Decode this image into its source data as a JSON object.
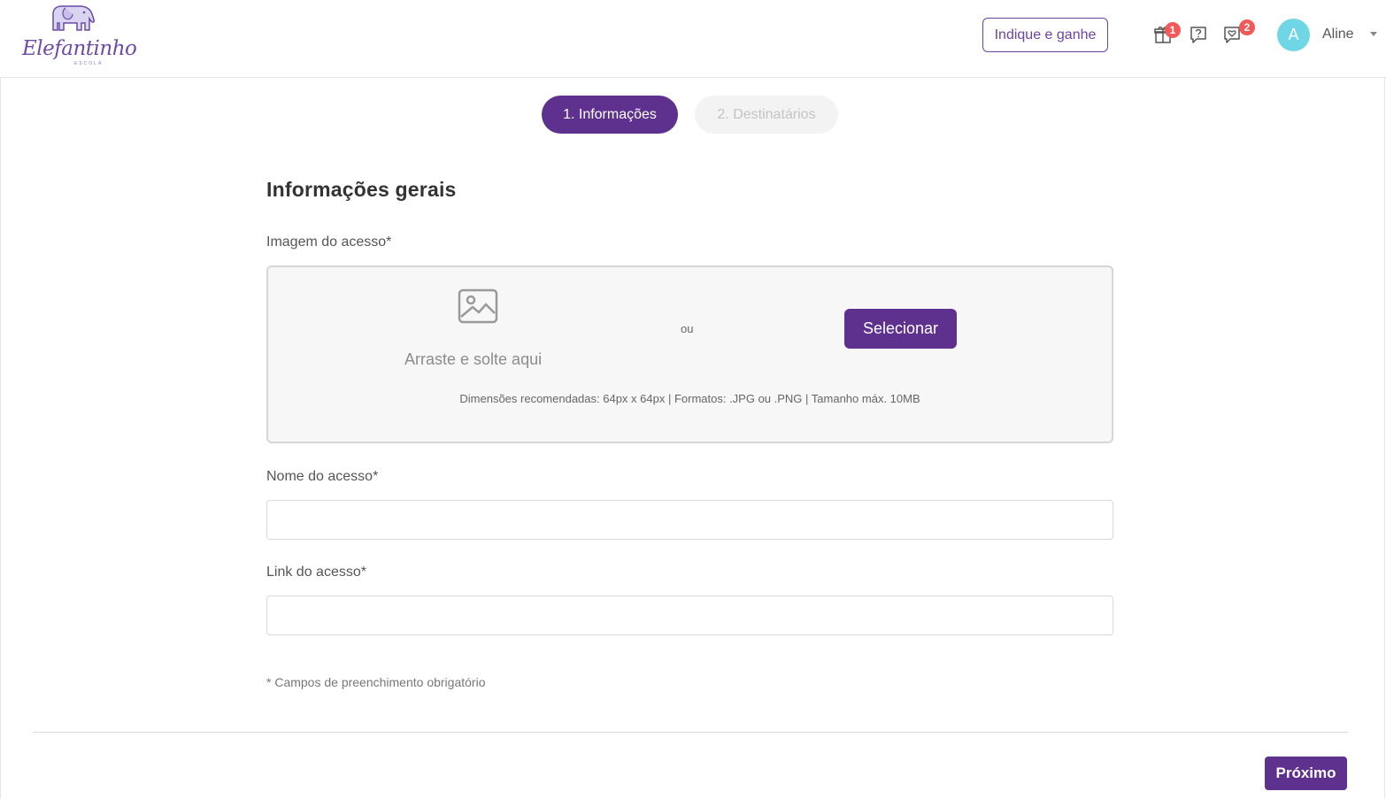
{
  "brand": {
    "logo_text": "Elefantinho",
    "logo_subtext": "ESCOLA",
    "accent_color": "#5e318f"
  },
  "header": {
    "refer_button": "Indique e ganhe",
    "icons": {
      "gift": {
        "icon": "gift-icon",
        "badge": "1"
      },
      "help": {
        "icon": "question-chat-icon"
      },
      "messages": {
        "icon": "chat-heart-icon",
        "badge": "2"
      }
    },
    "user": {
      "initial": "A",
      "name": "Aline"
    }
  },
  "steps": [
    {
      "label": "1. Informações",
      "state": "active"
    },
    {
      "label": "2. Destinatários",
      "state": "inactive"
    }
  ],
  "form": {
    "section_title": "Informações gerais",
    "image_label": "Imagem do acesso*",
    "dropzone": {
      "icon": "image-icon",
      "drag_text": "Arraste e solte aqui",
      "or_text": "ou",
      "select_button": "Selecionar",
      "hint": "Dimensões recomendadas: 64px x 64px | Formatos: .JPG ou .PNG | Tamanho máx. 10MB"
    },
    "name_label": "Nome do acesso*",
    "name_value": "",
    "link_label": "Link do acesso*",
    "link_value": "",
    "required_note": "* Campos de preenchimento obrigatório"
  },
  "footer": {
    "next_button": "Próximo"
  }
}
